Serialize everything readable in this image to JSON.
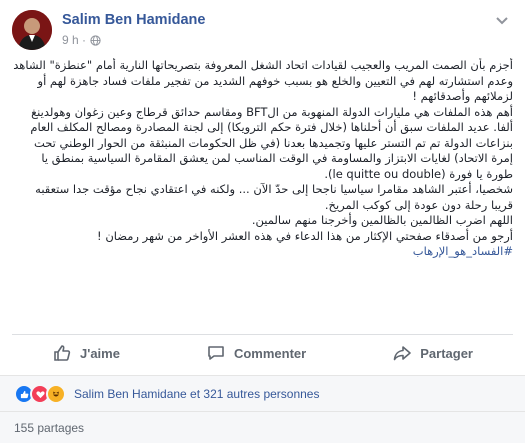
{
  "post": {
    "author": "Salim Ben Hamidane",
    "time": "9 h ·",
    "icons": [
      "globe-icon",
      "chevron-down-icon"
    ],
    "paragraphs": [
      "أجزم بأن الصمت المريب والعجيب لقيادات اتحاد الشغل المعروفة بتصريحاتها النارية أمام \"عنطزة\" الشاهد وعدم استشارته لهم في التعيين والخلع هو بسبب خوفهم الشديد من تفجير ملفات فساد جاهزة لهم أو لزملائهم وأصدقائهم !",
      "أهم هذه الملفات هي مليارات الدولة المنهوبة من الBFT ومقاسم حدائق قرطاج وعين زغوان وهولدينغ ألفا. عديد الملفات سبق أن أحلناها (خلال فترة حكم الترويكا) إلى لجنة المصادرة ومصالح المكلف العام بنزاعات الدولة تم تم التستر عليها وتجميدها بعدنا (في ظل الحكومات المنبثقة من الحوار الوطني تحت إمرة الاتحاد) لغايات الابتزاز والمساومة في الوقت المناسب لمن يعشق المقامرة السياسية بمنطق يا طورة يا فورة (le quitte ou double).",
      "شخصيا، أعتبر الشاهد مقامرا سياسيا ناجحا إلى حدّ الآن ... ولكنه في اعتقادي نجاح مؤقت جدا ستعقبه قريبا رحلة دون عودة إلى كوكب المريخ.",
      "اللهم اضرب الظالمين بالظالمين وأخرجنا منهم سالمين.",
      "أرجو من أصدقاء صفحتي الإكثار من هذا الدعاء في هذه العشر الأواخر من شهر رمضان !"
    ],
    "hashtag": "#الفساد_هو_الإرهاب"
  },
  "actions": {
    "like": "J'aime",
    "comment": "Commenter",
    "share": "Partager"
  },
  "reactions": {
    "text": "Salim Ben Hamidane et 321 autres personnes",
    "colors": {
      "like": "#1877f2",
      "love": "#f33e58",
      "haha": "#f7b125"
    }
  },
  "shares": {
    "text": "155 partages"
  },
  "colors": {
    "link": "#365899",
    "muted": "#606770"
  }
}
